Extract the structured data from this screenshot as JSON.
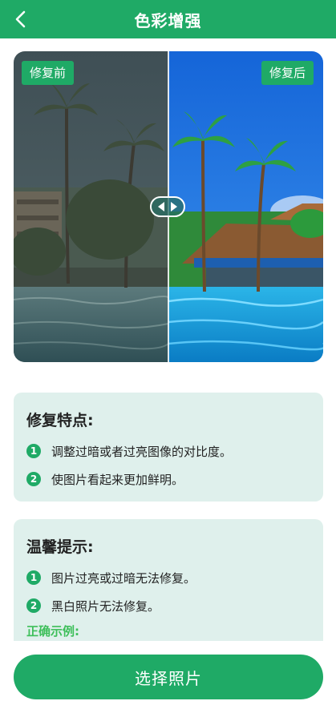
{
  "header": {
    "title": "色彩增强",
    "back_icon": "chevron-left-icon"
  },
  "compare": {
    "before_label": "修复前",
    "after_label": "修复后",
    "slider_icon": "left-right-arrows-icon",
    "slider_position": 0.5
  },
  "features": {
    "title": "修复特点:",
    "items": [
      {
        "num": "1",
        "text": "调整过暗或者过亮图像的对比度。"
      },
      {
        "num": "2",
        "text": "使图片看起来更加鲜明。"
      }
    ]
  },
  "tips": {
    "title": "温馨提示:",
    "items": [
      {
        "num": "1",
        "text": "图片过亮或过暗无法修复。"
      },
      {
        "num": "2",
        "text": "黑白照片无法修复。"
      }
    ],
    "example_label": "正确示例:"
  },
  "actions": {
    "select_photo": "选择照片"
  },
  "colors": {
    "primary": "#1faa66",
    "card_bg": "#dff0ec",
    "example_text": "#3dbf5a"
  }
}
